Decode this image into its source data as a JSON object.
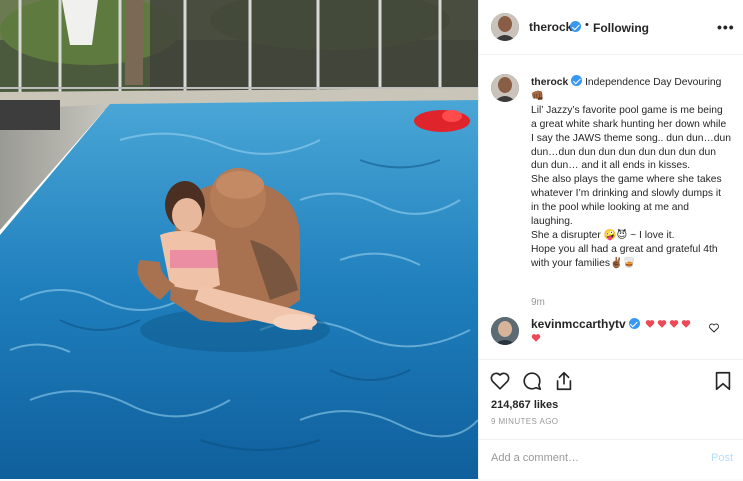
{
  "header": {
    "username": "therock",
    "separator": "•",
    "follow_status": "Following",
    "more_label": "•••"
  },
  "caption": {
    "username": "therock",
    "text": " Independence Day Devouring👊🏾\nLil’ Jazzy’s favorite pool game is me being a great white shark hunting her down while I say the JAWS theme song.. dun dun…dun dun…dun dun dun dun dun dun dun dun dun dun… and it all ends in kisses.\nShe also plays the game where she takes whatever I’m drinking and slowly dumps it in the pool while looking at me and laughing.\nShe a disrupter 🤪😈 ~ I love it.\nHope you all had a great and grateful 4th with your families✌🏾🥃",
    "timestamp": "9m"
  },
  "comment": {
    "username": "kevinmccarthytv",
    "hearts": [
      "❤️",
      "❤️",
      "❤️",
      "❤️",
      "❤️"
    ]
  },
  "engagement": {
    "likes": "214,867 likes",
    "time_ago": "9 MINUTES AGO"
  },
  "add_comment": {
    "placeholder": "Add a comment…",
    "post_label": "Post"
  },
  "icons": {
    "like": "heart-outline-icon",
    "comment": "comment-bubble-icon",
    "share": "share-icon",
    "save": "bookmark-icon",
    "verified": "verified-badge-icon"
  },
  "colors": {
    "verified_blue": "#3897f0",
    "post_disabled": "#b2dffc",
    "heart_red": "#ed4956"
  }
}
